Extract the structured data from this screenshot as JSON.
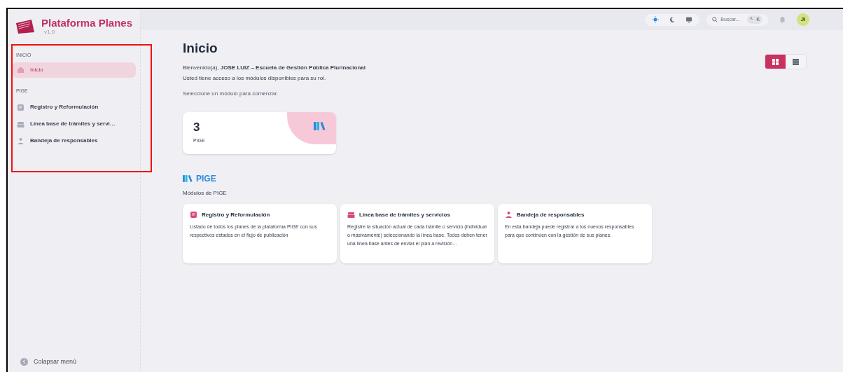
{
  "sidebar": {
    "app_title": "Plataforma Planes",
    "version": "v1.0",
    "sections": [
      {
        "heading": "INICIO",
        "items": [
          {
            "label": "Inicio",
            "kind": "home",
            "selected": true
          }
        ]
      },
      {
        "heading": "PIGE",
        "items": [
          {
            "label": "Registro y Reformulación",
            "kind": "doc",
            "selected": false
          },
          {
            "label": "Línea base de trámites y servi…",
            "kind": "tray",
            "selected": false
          },
          {
            "label": "Bandeja de responsables",
            "kind": "people",
            "selected": false
          }
        ]
      }
    ],
    "collapse": "Colapsar menú"
  },
  "header": {
    "themes": [
      {
        "kind": "light",
        "selected": true
      },
      {
        "kind": "dark",
        "selected": false
      },
      {
        "kind": "system",
        "selected": false
      }
    ],
    "search": {
      "placeholder": "Buscar...",
      "shortcut": "^ K"
    },
    "avatar": "JI"
  },
  "page": {
    "title": "Inicio",
    "welcome": "Bienvenido(a), **JOSE LUIZ – Escuela de Gestión Pública Plurinacional**",
    "access": "Usted tiene acceso a los módulos disponibles para su rol.",
    "prompt": "Seleccione un módulo para comenzar.",
    "views": [
      {
        "kind": "grid",
        "selected": true
      },
      {
        "kind": "list",
        "selected": false
      }
    ],
    "stat": {
      "value": "3",
      "label": "PIGE"
    },
    "section": {
      "title": "PIGE",
      "subtitle": "Módulos de PIGE"
    },
    "modules": [
      {
        "kind": "doc",
        "title": "Registro y Reformulación",
        "description": "Listado de todos los planes de la plataforma PIGE con sus respectivos estados en el flujo de publicación"
      },
      {
        "kind": "tray",
        "title": "Línea base de trámites y servicios",
        "description": "Registre la situación actual de cada trámite o servicio (individual o masivamente) seleccionando la línea base. Todos deben tener una línea base antes de enviar el plan a revisión…"
      },
      {
        "kind": "people",
        "title": "Bandeja de responsables",
        "description": "En esta bandeja puede registrar a los nuevos responsables para que continúen con la gestión de sus planes."
      }
    ]
  }
}
